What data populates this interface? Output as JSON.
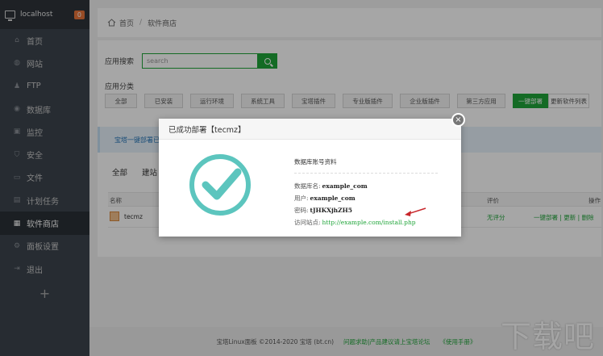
{
  "sidebar": {
    "host": "localhost",
    "badge": "0",
    "items": [
      {
        "label": "首页",
        "icon": "home-icon"
      },
      {
        "label": "网站",
        "icon": "globe-icon"
      },
      {
        "label": "FTP",
        "icon": "user-icon"
      },
      {
        "label": "数据库",
        "icon": "database-icon"
      },
      {
        "label": "监控",
        "icon": "monitor-icon"
      },
      {
        "label": "安全",
        "icon": "shield-icon"
      },
      {
        "label": "文件",
        "icon": "folder-icon"
      },
      {
        "label": "计划任务",
        "icon": "calendar-icon"
      },
      {
        "label": "软件商店",
        "icon": "grid-icon"
      },
      {
        "label": "面板设置",
        "icon": "gear-icon"
      },
      {
        "label": "退出",
        "icon": "logout-icon"
      }
    ],
    "plus": "+"
  },
  "breadcrumb": {
    "home": "首页",
    "sep": "/",
    "current": "软件商店"
  },
  "search": {
    "label": "应用搜索",
    "placeholder": "search"
  },
  "categories": {
    "label": "应用分类",
    "items": [
      "全部",
      "已安装",
      "运行环境",
      "系统工具",
      "宝塔插件",
      "专业版插件",
      "企业版插件",
      "第三方应用"
    ],
    "deploy": "一键部署",
    "update": "更新软件列表"
  },
  "notice": "宝塔一键部署已上",
  "tabs": [
    "全部",
    "建站"
  ],
  "table": {
    "headers": {
      "name": "名称",
      "rating": "评价",
      "action": "操作"
    },
    "row": {
      "name": "tecmz",
      "rating": "无评分",
      "actions": "一键部署 | 更新 | 删除"
    }
  },
  "footer": {
    "copyright": "宝塔Linux面板 ©2014-2020 宝塔 (bt.cn)",
    "forum": "问题求助|产品建议请上宝塔论坛",
    "manual": "《使用手册》"
  },
  "watermark": "下载吧",
  "modal": {
    "title": "已成功部署【tecmz】",
    "close": "×",
    "info_title": "数据库账号资料",
    "db_name_label": "数据库名:",
    "db_name": "example_com",
    "user_label": "用户:",
    "user": "example_com",
    "pass_label": "密码:",
    "pass": "tJHKXjhZH5",
    "site_label": "访问站点:",
    "site_url": "http://example.com/install.php"
  },
  "colors": {
    "accent": "#20a53a",
    "sidebar": "#3c444d",
    "arrow": "#c8262b"
  }
}
